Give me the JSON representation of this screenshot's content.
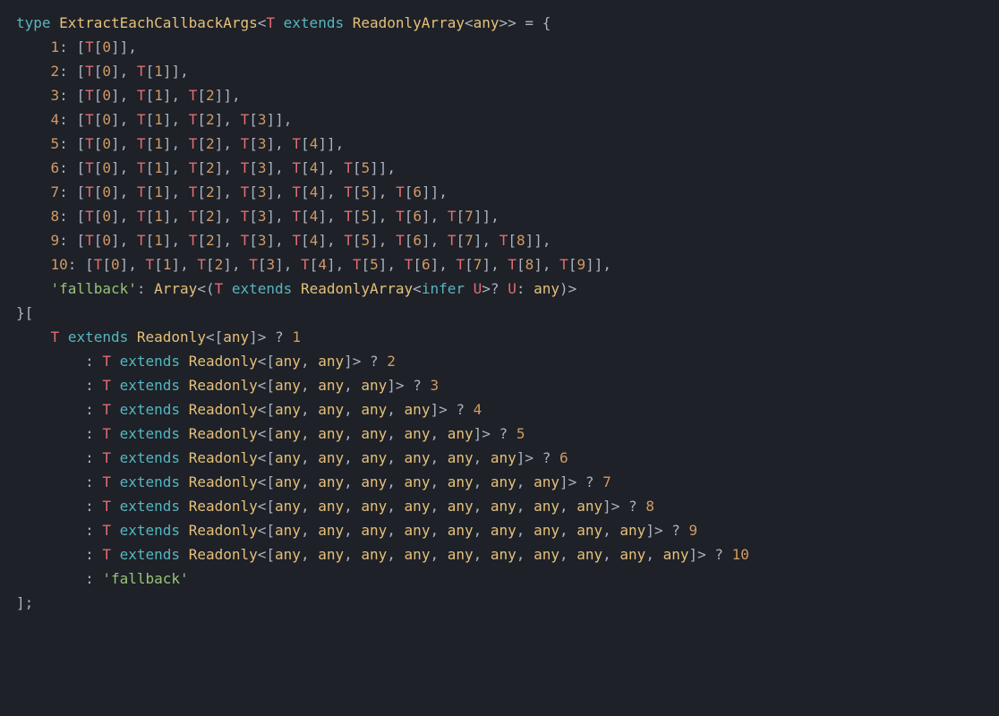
{
  "code": {
    "typeName": "ExtractEachCallbackArgs",
    "param": "T",
    "constraint": "ReadonlyArray",
    "constraintArg": "any",
    "rows": [
      {
        "key": "1",
        "count": 1
      },
      {
        "key": "2",
        "count": 2
      },
      {
        "key": "3",
        "count": 3
      },
      {
        "key": "4",
        "count": 4
      },
      {
        "key": "5",
        "count": 5
      },
      {
        "key": "6",
        "count": 6
      },
      {
        "key": "7",
        "count": 7
      },
      {
        "key": "8",
        "count": 8
      },
      {
        "key": "9",
        "count": 9
      },
      {
        "key": "10",
        "count": 10
      }
    ],
    "fallbackKey": "'fallback'",
    "fallbackType": {
      "outer": "Array",
      "inner": "ReadonlyArray",
      "inferVar": "U",
      "else": "any"
    },
    "conditions": [
      {
        "count": 1,
        "result": "1"
      },
      {
        "count": 2,
        "result": "2"
      },
      {
        "count": 3,
        "result": "3"
      },
      {
        "count": 4,
        "result": "4"
      },
      {
        "count": 5,
        "result": "5"
      },
      {
        "count": 6,
        "result": "6"
      },
      {
        "count": 7,
        "result": "7"
      },
      {
        "count": 8,
        "result": "8"
      },
      {
        "count": 9,
        "result": "9"
      },
      {
        "count": 10,
        "result": "10"
      }
    ],
    "fallbackResult": "'fallback'",
    "readonly": "Readonly",
    "anyTok": "any",
    "kw": {
      "type": "type",
      "extends": "extends",
      "infer": "infer"
    }
  }
}
